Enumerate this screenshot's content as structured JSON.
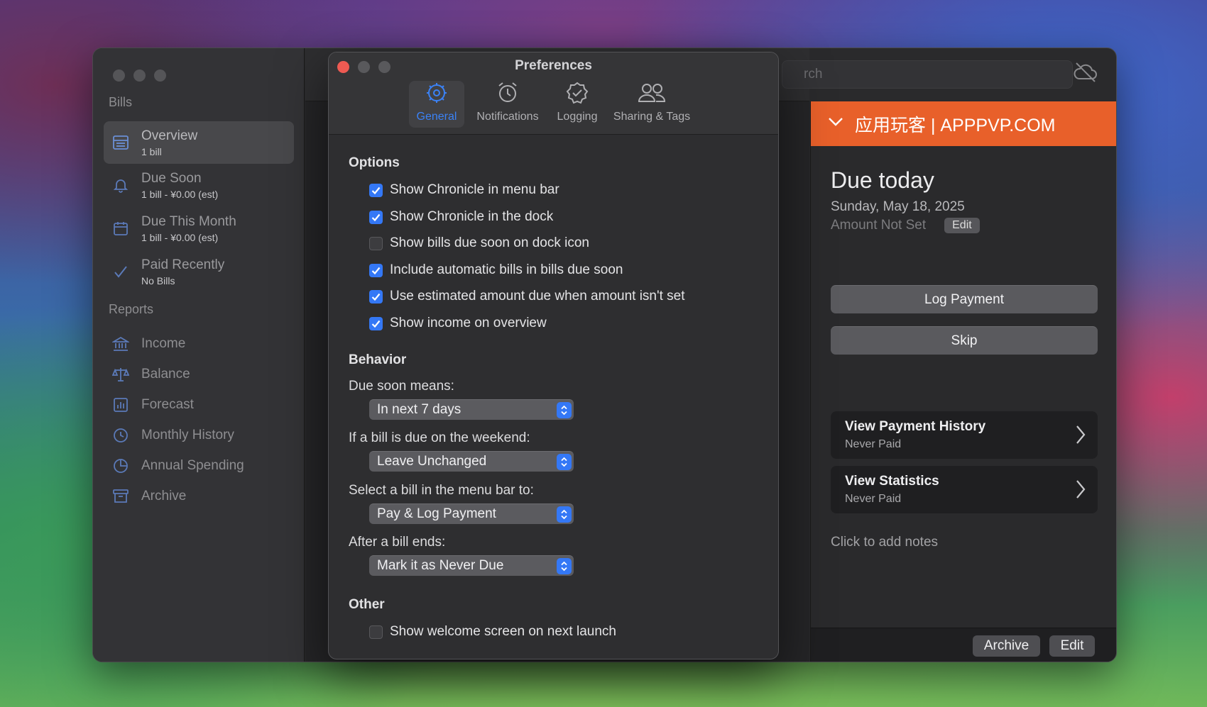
{
  "sidebar": {
    "bills_title": "Bills",
    "items": [
      {
        "label": "Overview",
        "sub": "1 bill",
        "icon": "list-icon"
      },
      {
        "label": "Due Soon",
        "sub": "1 bill - ¥0.00 (est)",
        "icon": "bell-icon"
      },
      {
        "label": "Due This Month",
        "sub": "1 bill - ¥0.00 (est)",
        "icon": "calendar-icon"
      },
      {
        "label": "Paid Recently",
        "sub": "No Bills",
        "icon": "checkmark-icon"
      }
    ],
    "reports_title": "Reports",
    "reports": [
      {
        "label": "Income",
        "icon": "bank-icon"
      },
      {
        "label": "Balance",
        "icon": "scale-icon"
      },
      {
        "label": "Forecast",
        "icon": "bar-chart-icon"
      },
      {
        "label": "Monthly History",
        "icon": "clock-icon"
      },
      {
        "label": "Annual Spending",
        "icon": "pie-chart-icon"
      },
      {
        "label": "Archive",
        "icon": "archive-box-icon"
      }
    ]
  },
  "toolbar": {
    "search_text": "rch"
  },
  "detail": {
    "banner": "应用玩客 | APPPVP.COM",
    "banner_color": "#e8602a",
    "due_title": "Due today",
    "due_date": "Sunday, May 18, 2025",
    "amount": "Amount Not Set",
    "amount_edit": "Edit",
    "log_payment": "Log Payment",
    "skip": "Skip",
    "cards": [
      {
        "title": "View Payment History",
        "sub": "Never Paid"
      },
      {
        "title": "View Statistics",
        "sub": "Never Paid"
      }
    ],
    "notes": "Click to add notes",
    "archive_btn": "Archive",
    "edit_btn": "Edit"
  },
  "prefs": {
    "title": "Preferences",
    "tabs": [
      {
        "label": "General",
        "icon": "gear-icon"
      },
      {
        "label": "Notifications",
        "icon": "alarm-clock-icon"
      },
      {
        "label": "Logging",
        "icon": "checkmark-seal-icon"
      },
      {
        "label": "Sharing & Tags",
        "icon": "people-icon"
      }
    ],
    "options_header": "Options",
    "options": [
      {
        "label": "Show Chronicle in menu bar",
        "checked": true
      },
      {
        "label": "Show Chronicle in the dock",
        "checked": true
      },
      {
        "label": "Show bills due soon on dock icon",
        "checked": false
      },
      {
        "label": "Include automatic bills in bills due soon",
        "checked": true
      },
      {
        "label": "Use estimated amount due when amount isn't set",
        "checked": true
      },
      {
        "label": "Show income on overview",
        "checked": true
      }
    ],
    "behavior_header": "Behavior",
    "behaviors": [
      {
        "label": "Due soon means:",
        "value": "In next 7 days"
      },
      {
        "label": "If a bill is due on the weekend:",
        "value": "Leave Unchanged"
      },
      {
        "label": "Select a bill in the menu bar to:",
        "value": "Pay & Log Payment"
      },
      {
        "label": "After a bill ends:",
        "value": "Mark it as Never Due"
      }
    ],
    "other_header": "Other",
    "other_option": {
      "label": "Show welcome screen on next launch",
      "checked": false
    },
    "accent": "#3478f6"
  }
}
